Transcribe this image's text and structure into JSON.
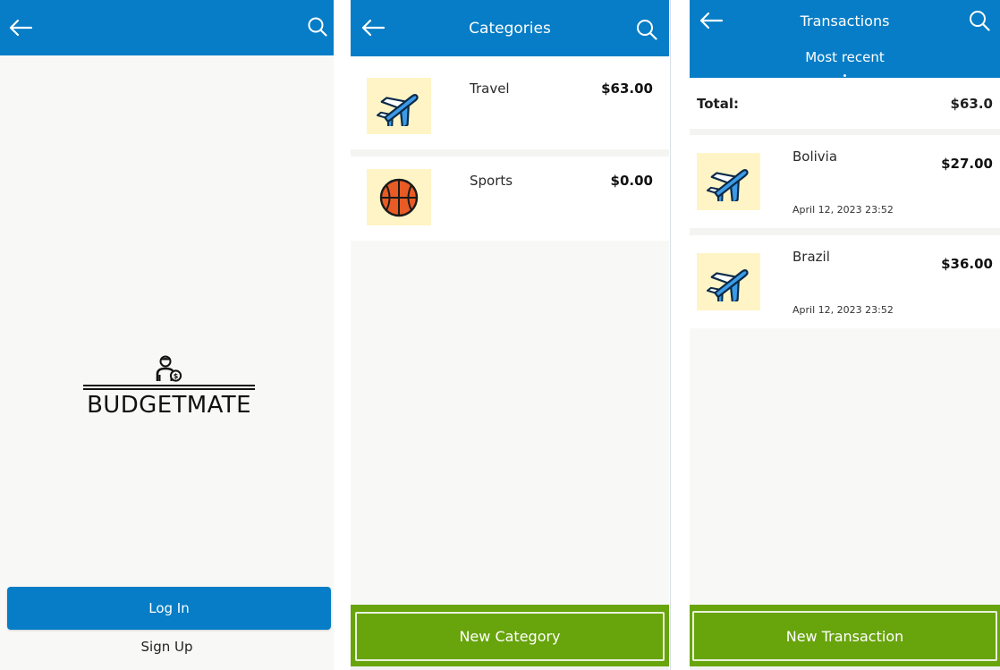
{
  "login_screen": {
    "brand": {
      "name": "BUDGETMATE",
      "icon_name": "person-dollar-icon"
    },
    "login_label": "Log In",
    "signup_label": "Sign Up",
    "header_icons": [
      "back-arrow-icon",
      "search-icon"
    ]
  },
  "categories_screen": {
    "title": "Categories",
    "items": [
      {
        "label": "Travel",
        "amount": "$63.00",
        "icon_name": "airplane-icon"
      },
      {
        "label": "Sports",
        "amount": "$0.00",
        "icon_name": "basketball-icon"
      }
    ],
    "new_button_label": "New Category",
    "header_icons": [
      "back-arrow-icon",
      "search-icon"
    ]
  },
  "transactions_screen": {
    "title": "Transactions",
    "subtitle": "Most recent",
    "total_label": "Total:",
    "total_value": "$63.0",
    "items": [
      {
        "label": "Bolivia",
        "amount": "$27.00",
        "date": "April 12, 2023 23:52",
        "icon_name": "airplane-icon"
      },
      {
        "label": "Brazil",
        "amount": "$36.00",
        "date": "April 12, 2023 23:52",
        "icon_name": "airplane-icon"
      }
    ],
    "new_button_label": "New Transaction",
    "header_icons": [
      "back-arrow-icon",
      "search-icon"
    ]
  },
  "colors": {
    "header_blue": "#067dc6",
    "action_green": "#68a40c",
    "icon_tile": "#fff4c5",
    "background": "#f8f8f6"
  }
}
